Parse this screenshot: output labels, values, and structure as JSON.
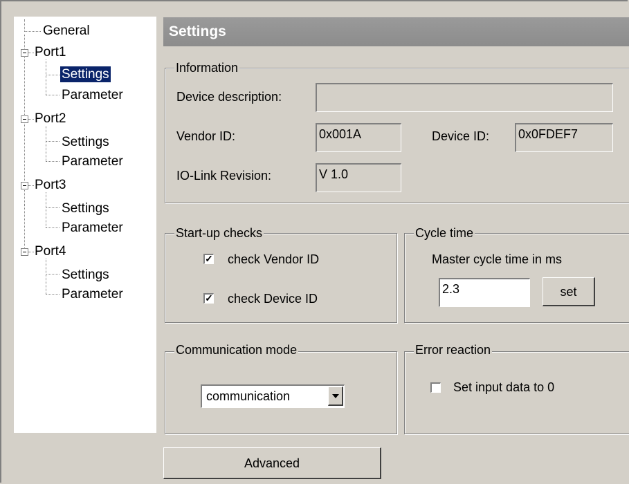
{
  "tree": {
    "general": "General",
    "ports": [
      {
        "label": "Port1",
        "settings": "Settings",
        "parameter": "Parameter"
      },
      {
        "label": "Port2",
        "settings": "Settings",
        "parameter": "Parameter"
      },
      {
        "label": "Port3",
        "settings": "Settings",
        "parameter": "Parameter"
      },
      {
        "label": "Port4",
        "settings": "Settings",
        "parameter": "Parameter"
      }
    ],
    "selected": "Port1 > Settings"
  },
  "header": {
    "title": "Settings"
  },
  "information": {
    "title": "Information",
    "device_description_label": "Device description:",
    "device_description_value": "",
    "vendor_id_label": "Vendor ID:",
    "vendor_id_value": "0x001A",
    "device_id_label": "Device ID:",
    "device_id_value": "0x0FDEF7",
    "iolink_revision_label": "IO-Link Revision:",
    "iolink_revision_value": "V 1.0"
  },
  "startup_checks": {
    "title": "Start-up checks",
    "check_vendor_label": "check Vendor ID",
    "check_vendor_checked": true,
    "check_device_label": "check Device ID",
    "check_device_checked": true
  },
  "cycle_time": {
    "title": "Cycle time",
    "label": "Master cycle time in ms",
    "value": "2.3",
    "set_label": "set"
  },
  "communication_mode": {
    "title": "Communication mode",
    "selected": "communication"
  },
  "error_reaction": {
    "title": "Error reaction",
    "checkbox_label": "Set input data to 0",
    "checked": false
  },
  "advanced_label": "Advanced",
  "colors": {
    "selection": "#0a246a",
    "header": "#8c8c8c",
    "face": "#d4d0c8"
  }
}
